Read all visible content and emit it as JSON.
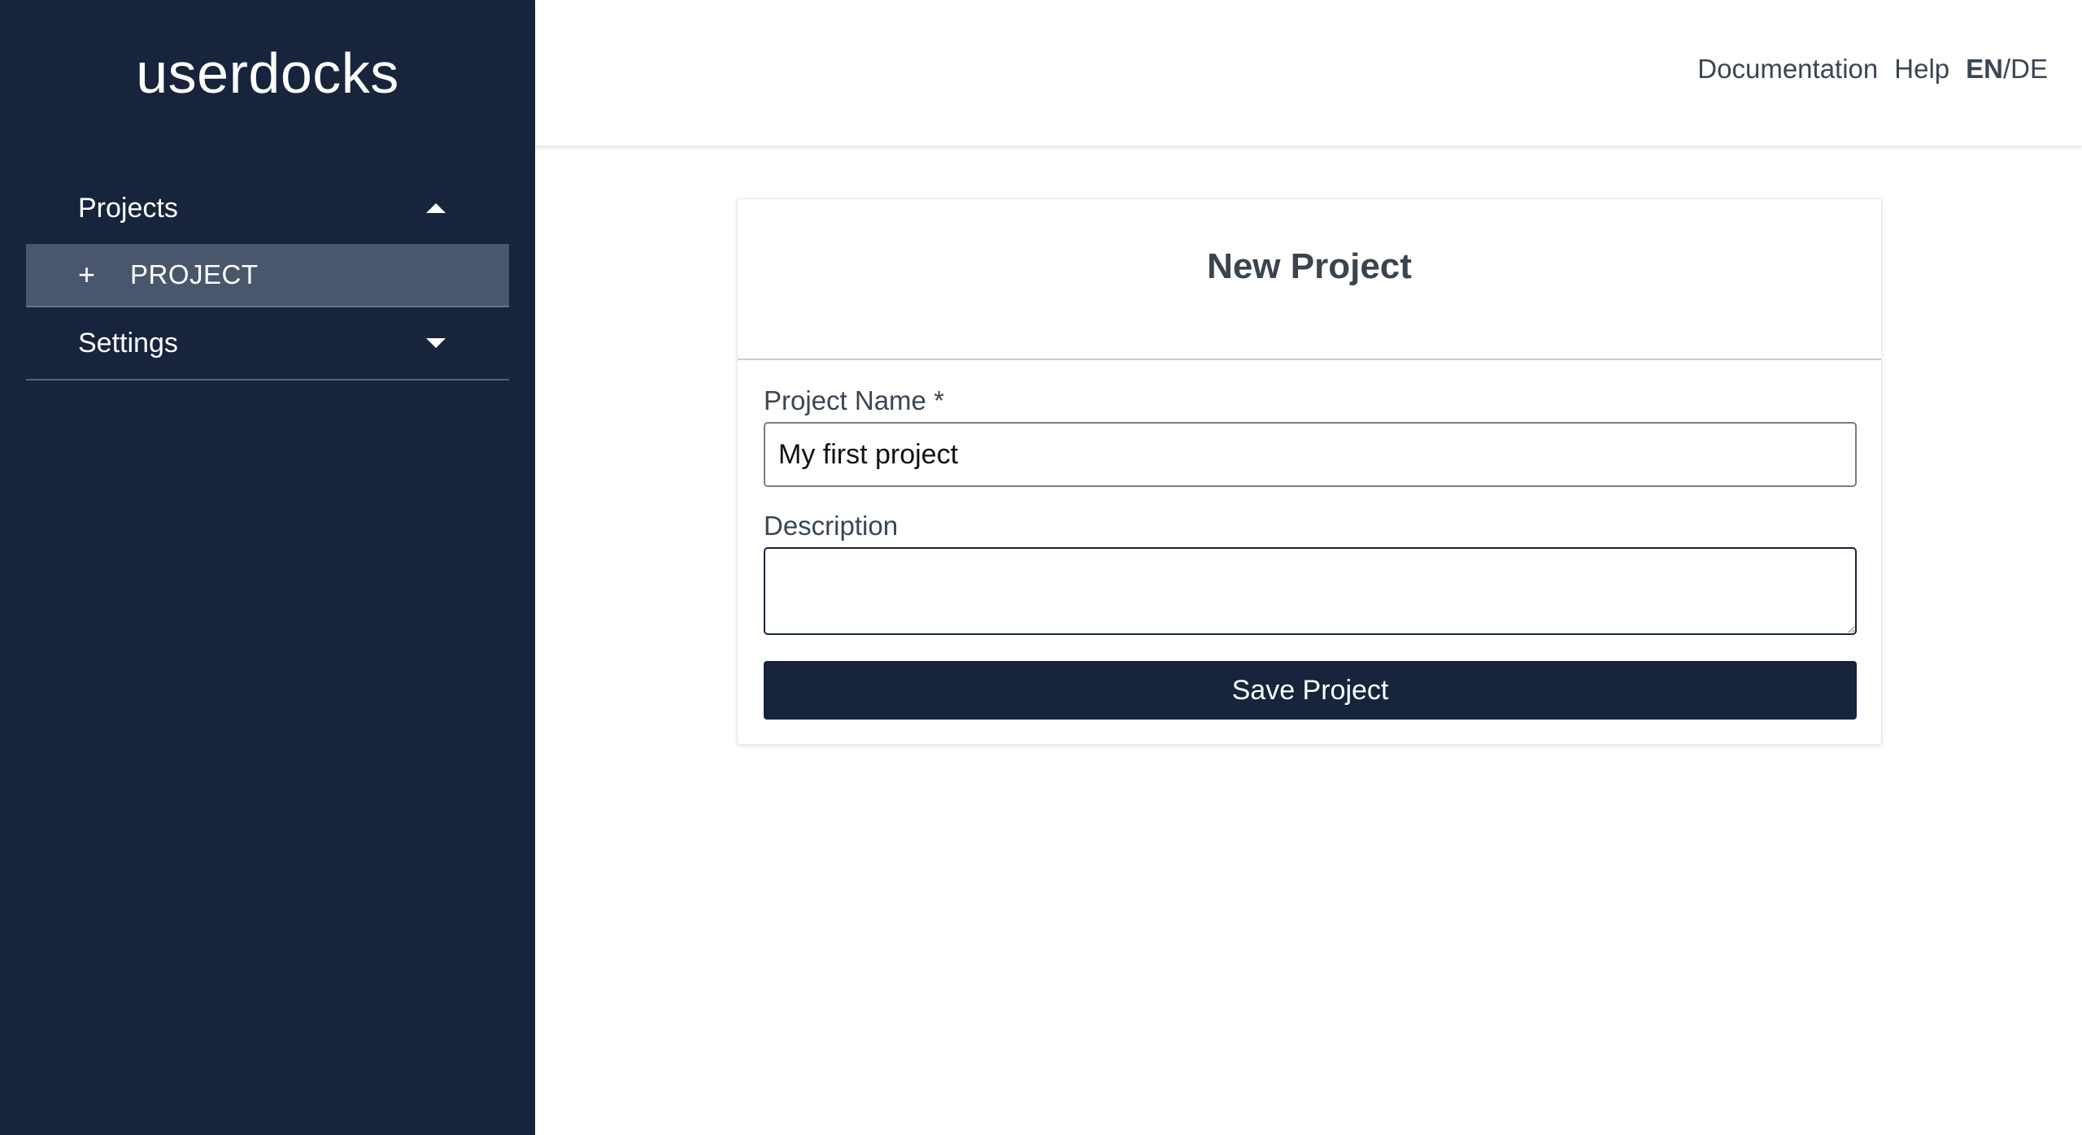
{
  "sidebar": {
    "brand": "userdocks",
    "sections": [
      {
        "label": "Projects",
        "expanded": true,
        "caret": "caret-up-icon"
      },
      {
        "label": "Settings",
        "expanded": false,
        "caret": "caret-down-icon"
      }
    ],
    "project_sub": {
      "icon": "plus-icon",
      "icon_glyph": "+",
      "label": "PROJECT"
    }
  },
  "header": {
    "links": {
      "documentation": "Documentation",
      "help": "Help"
    },
    "language": {
      "active": "EN",
      "separator": "/",
      "other": "DE"
    }
  },
  "form": {
    "title": "New Project",
    "project_name": {
      "label": "Project Name *",
      "value": "My first project"
    },
    "description": {
      "label": "Description",
      "value": ""
    },
    "save_label": "Save Project"
  },
  "colors": {
    "sidebar_bg": "#17243c",
    "sidebar_active_item": "#4a566b",
    "primary_button": "#17243c",
    "text": "#3b4652"
  }
}
